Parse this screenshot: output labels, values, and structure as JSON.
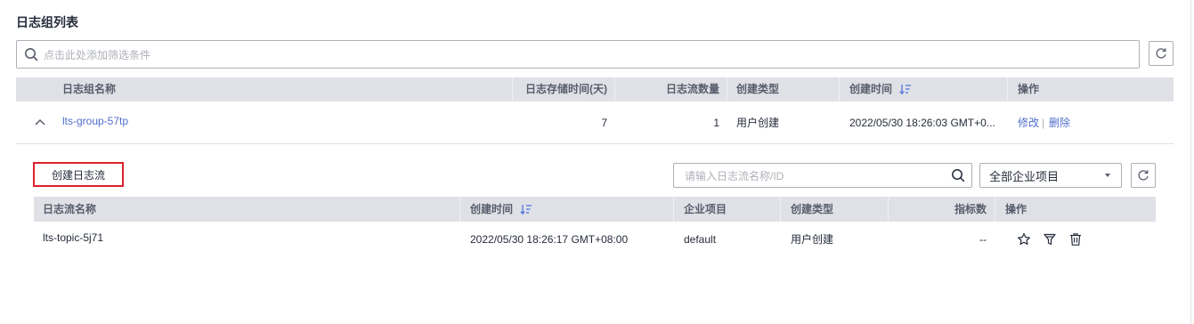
{
  "page": {
    "title": "日志组列表"
  },
  "filter": {
    "placeholder": "点击此处添加筛选条件"
  },
  "group_table": {
    "headers": {
      "name": "日志组名称",
      "retention": "日志存储时间(天)",
      "stream_count": "日志流数量",
      "create_type": "创建类型",
      "create_time": "创建时间",
      "actions": "操作"
    },
    "row": {
      "name": "lts-group-57tp",
      "retention": "7",
      "stream_count": "1",
      "create_type": "用户创建",
      "create_time": "2022/05/30 18:26:03 GMT+0...",
      "edit": "修改",
      "separator": "|",
      "delete": "删除"
    }
  },
  "stream_section": {
    "create_button": "创建日志流",
    "search_placeholder": "请输入日志流名称/ID",
    "enterprise_select": "全部企业项目",
    "headers": {
      "name": "日志流名称",
      "create_time": "创建时间",
      "enterprise": "企业项目",
      "create_type": "创建类型",
      "metrics": "指标数",
      "actions": "操作"
    },
    "row": {
      "name": "lts-topic-5j71",
      "create_time": "2022/05/30 18:26:17 GMT+08:00",
      "enterprise": "default",
      "create_type": "用户创建",
      "metrics": "--"
    }
  },
  "colors": {
    "link": "#526ecc",
    "header_bg": "#dfe1e6",
    "highlight_border": "#e0202a",
    "sort_icon": "#5e7ce0"
  }
}
